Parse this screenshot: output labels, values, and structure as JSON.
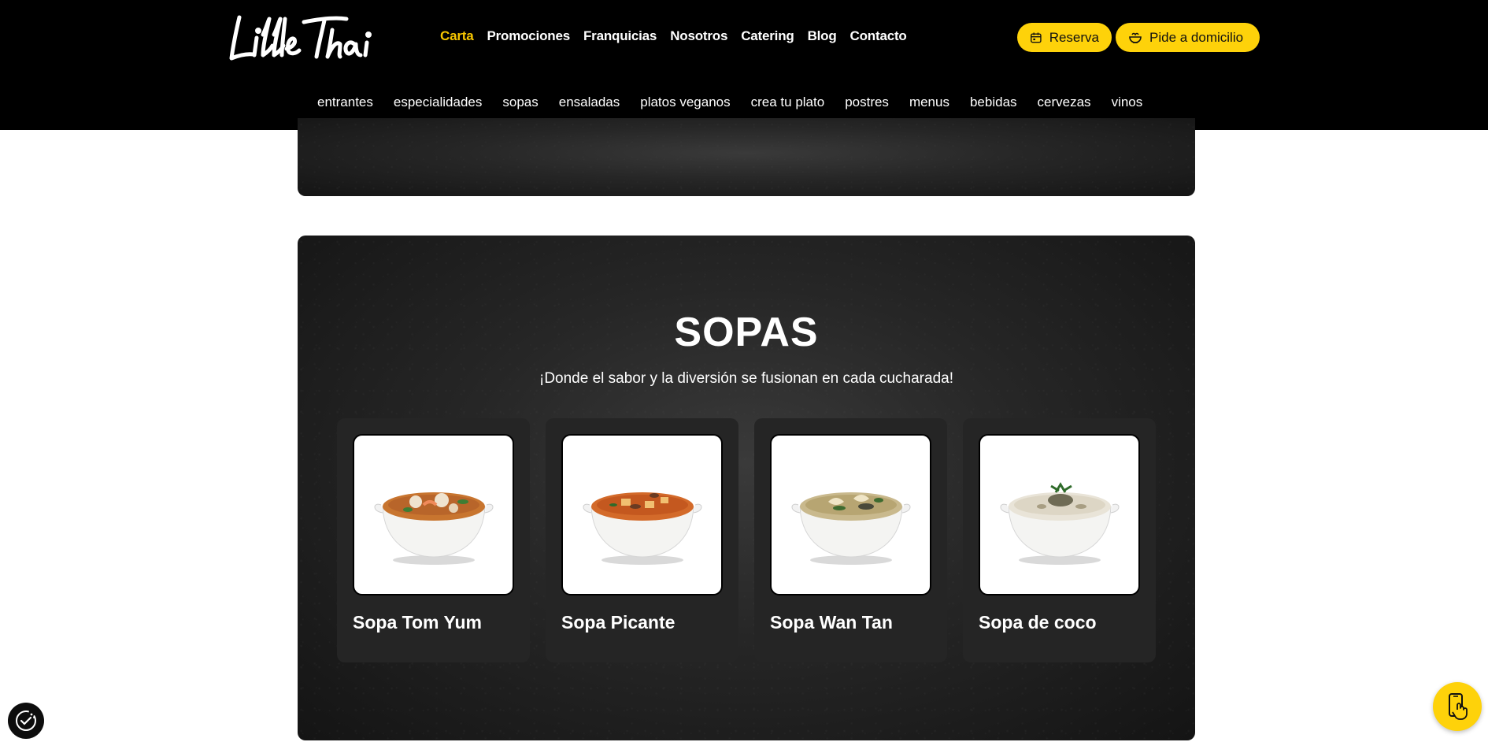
{
  "brand": {
    "logo_text": "LittleThai"
  },
  "main_nav": [
    {
      "label": "Carta",
      "active": true
    },
    {
      "label": "Promociones",
      "active": false
    },
    {
      "label": "Franquicias",
      "active": false
    },
    {
      "label": "Nosotros",
      "active": false
    },
    {
      "label": "Catering",
      "active": false
    },
    {
      "label": "Blog",
      "active": false
    },
    {
      "label": "Contacto",
      "active": false
    }
  ],
  "actions": {
    "reserva_label": "Reserva",
    "reserva_icon": "calendar-icon",
    "domicilio_label": "Pide a domicilio",
    "domicilio_icon": "bowl-icon"
  },
  "sub_nav": [
    {
      "label": "entrantes",
      "active": false
    },
    {
      "label": "especialidades",
      "active": false
    },
    {
      "label": "sopas",
      "active": true
    },
    {
      "label": "ensaladas",
      "active": false
    },
    {
      "label": "platos veganos",
      "active": false
    },
    {
      "label": "crea tu plato",
      "active": false
    },
    {
      "label": "postres",
      "active": false
    },
    {
      "label": "menus",
      "active": false
    },
    {
      "label": "bebidas",
      "active": false
    },
    {
      "label": "cervezas",
      "active": false
    },
    {
      "label": "vinos",
      "active": false
    }
  ],
  "section": {
    "title": "SOPAS",
    "subtitle": "¡Donde el sabor y la diversión se fusionan en cada cucharada!"
  },
  "products": [
    {
      "name": "Sopa Tom Yum",
      "image": "tom-yum-soup-bowl"
    },
    {
      "name": "Sopa Picante",
      "image": "spicy-soup-bowl"
    },
    {
      "name": "Sopa Wan Tan",
      "image": "wonton-soup-bowl"
    },
    {
      "name": "Sopa de coco",
      "image": "coconut-soup-bowl"
    }
  ],
  "colors": {
    "accent": "#fed20a",
    "active_nav": "#f7c600",
    "header_bg": "#000000",
    "card_bg": "#252525"
  },
  "widgets": {
    "consent_icon": "cookie-consent-icon",
    "app_icon": "mobile-app-icon"
  }
}
